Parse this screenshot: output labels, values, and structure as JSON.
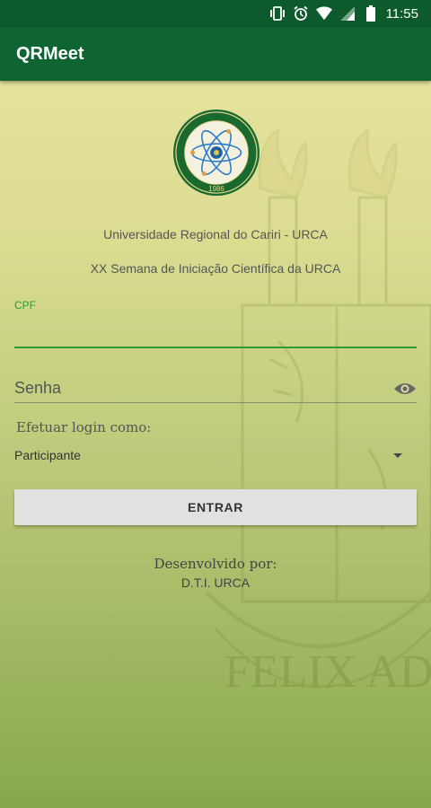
{
  "status_bar": {
    "time": "11:55",
    "icons": [
      "vibrate-icon",
      "alarm-icon",
      "wifi-icon",
      "signal-icon",
      "battery-icon"
    ]
  },
  "app_bar": {
    "title": "QRMeet"
  },
  "logo": {
    "year": "1986"
  },
  "header": {
    "university": "Universidade Regional do Cariri - URCA",
    "event": "XX Semana de Iniciação Científica da URCA"
  },
  "form": {
    "cpf_label": "CPF",
    "cpf_value": "",
    "password_hint": "Senha",
    "login_as_label": "Efetuar login como:",
    "role_selected": "Participante",
    "submit_label": "ENTRAR"
  },
  "footer": {
    "developed_by": "Desenvolvido por:",
    "developer": "D.T.I. URCA"
  },
  "watermark_text": "FELIX AD SA",
  "colors": {
    "status_bar": "#0d5a2c",
    "app_bar": "#0f6531",
    "accent": "#2a9a3a",
    "button": "#e1e1e1"
  }
}
